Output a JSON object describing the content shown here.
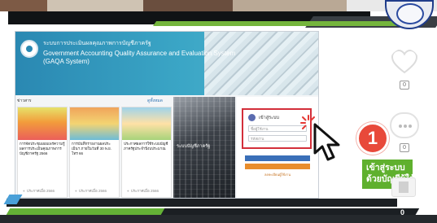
{
  "portal": {
    "title_th": "ระบบการประเมินผลคุณภาพการบัญชีภาครัฐ",
    "title_en": "Government Accounting Quality Assurance and Evaluation System",
    "title_abbr": "(GAQA System)",
    "news_label": "ข่าวสาร",
    "news_more": "ดูทั้งหมด",
    "news": [
      {
        "title": "การจัดประชุมเผยแพร่ความรู้ผลการประเมินคุณภาพการบัญชีภาครัฐ 2566",
        "date": "ประกาศเมื่อ 2566"
      },
      {
        "title": "การบันทึกรายงานผลประเมินฯ ภายในวันที่ 30 พ.ย. โทร 66",
        "date": "ประกาศเมื่อ 2566"
      },
      {
        "title": "ประกาศผลการใช้ระบบบัญชีภาครัฐประจำปีงบประมาณ",
        "date": "ประกาศเมื่อ 2566"
      }
    ],
    "banner_text": "ระบบบัญชีภาครัฐ",
    "login": {
      "heading": "เข้าสู่ระบบ",
      "username_placeholder": "ชื่อผู้ใช้งาน",
      "password_placeholder": "รหัสผ่าน",
      "link_text": "ลงทะเบียนผู้ใช้งาน"
    }
  },
  "callout": {
    "step_number": "1",
    "line1": "เข้าสู่ระบบ",
    "line2": "ด้วยบัญชีผู้ใช้งาน"
  },
  "reactions": {
    "likes": "0",
    "comments": "0",
    "shares": "0"
  },
  "colors": {
    "accent_green": "#5fb02e",
    "step_red": "#e8493a",
    "login_highlight": "#d32f3a"
  }
}
